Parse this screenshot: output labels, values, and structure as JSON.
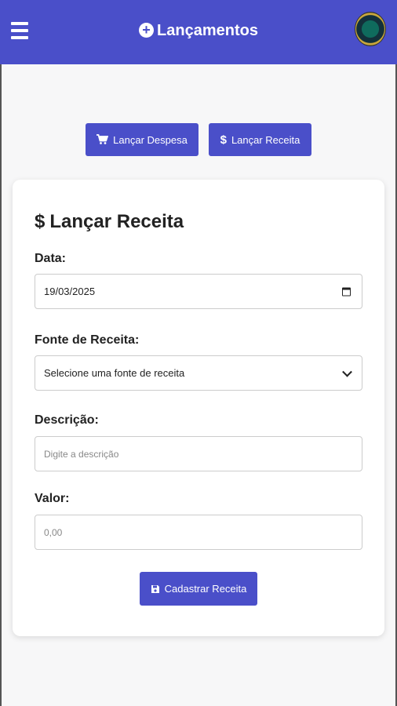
{
  "header": {
    "title": "Lançamentos",
    "menu_icon": "hamburger-icon",
    "title_icon": "plus-circle-icon",
    "accent_color": "#4a4fc9"
  },
  "actions": {
    "despesa_label": "Lançar Despesa",
    "despesa_icon": "cart-icon",
    "receita_label": "Lançar Receita",
    "receita_icon": "dollar-icon"
  },
  "form": {
    "title_symbol": "$",
    "title": "Lançar Receita",
    "date_label": "Data:",
    "date_value": "19/03/2025",
    "source_label": "Fonte de Receita:",
    "source_selected": "Selecione uma fonte de receita",
    "description_label": "Descrição:",
    "description_placeholder": "Digite a descrição",
    "value_label": "Valor:",
    "value_placeholder": "0,00",
    "submit_label": "Cadastrar Receita",
    "submit_icon": "save-icon"
  }
}
